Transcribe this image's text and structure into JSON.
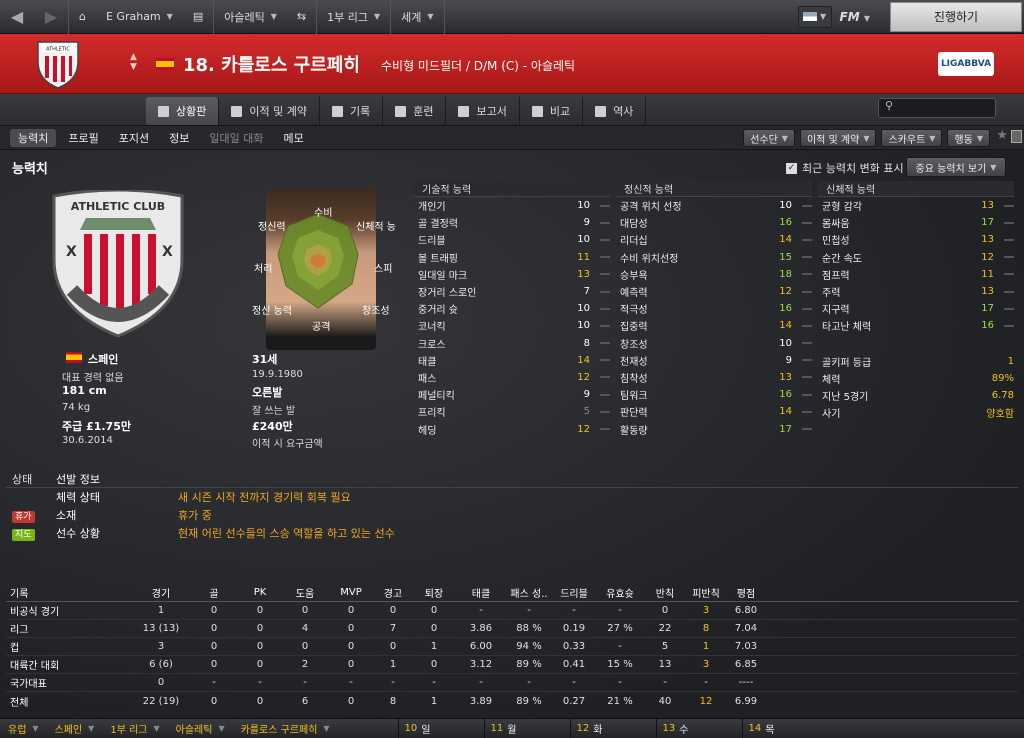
{
  "topbar": {
    "manager": "E Graham",
    "club": "아슬레틱",
    "league": "1부 리그",
    "world": "세계",
    "fm": "FM",
    "continue": "진행하기"
  },
  "header": {
    "player_title": "18. 카를로스 구르페히",
    "position_club": "수비형 미드필더 / D/M (C) - 아슬레틱",
    "league_logo": "LIGABBVA",
    "club_crest_text": "ATHLETIC CLUB"
  },
  "tabs": [
    {
      "label": "상황판",
      "icon": "dashboard-icon"
    },
    {
      "label": "이적 및 계약",
      "icon": "contract-icon"
    },
    {
      "label": "기록",
      "icon": "stats-icon"
    },
    {
      "label": "훈련",
      "icon": "training-icon"
    },
    {
      "label": "보고서",
      "icon": "report-icon"
    },
    {
      "label": "비교",
      "icon": "compare-icon"
    },
    {
      "label": "역사",
      "icon": "history-icon"
    }
  ],
  "search_placeholder": "",
  "subtabs": [
    "능력치",
    "프로필",
    "포지션",
    "정보",
    "일대일 대화",
    "메모"
  ],
  "subtab_active": "능력치",
  "action_buttons": [
    "선수단",
    "이적 및 계약",
    "스카우트",
    "행동"
  ],
  "section_title": "능력치",
  "show_changes_label": "최근 능력치 변화 표시",
  "key_attrs_button": "중요 능력치 보기",
  "radar_labels": {
    "top": "수비",
    "tl": "정신력",
    "tr": "신체적 능",
    "ml": "처리",
    "mr": "스피",
    "bl": "정신 능력",
    "br": "창조성",
    "bottom": "공격"
  },
  "player_info": {
    "nationality": "스페인",
    "intl": "대표 경력 없음",
    "height": "181 cm",
    "weight": "74 kg",
    "wage": "주급 £1.75만",
    "contract_end": "30.6.2014",
    "age": "31세",
    "dob": "19.9.1980",
    "foot": "오른발",
    "foot_detail": "잘 쓰는 발",
    "value": "£240만",
    "transfer_status": "이적 시 요구금액"
  },
  "technical": {
    "title": "기술적 능력",
    "rows": [
      {
        "name": "개인기",
        "value": "10",
        "color": "white"
      },
      {
        "name": "골 결정력",
        "value": "9",
        "color": "white"
      },
      {
        "name": "드리블",
        "value": "10",
        "color": "white"
      },
      {
        "name": "볼 트래핑",
        "value": "11",
        "color": "yellow"
      },
      {
        "name": "일대일 마크",
        "value": "13",
        "color": "yellow"
      },
      {
        "name": "장거리 스로인",
        "value": "7",
        "color": "white"
      },
      {
        "name": "중거리 슛",
        "value": "10",
        "color": "white"
      },
      {
        "name": "코너킥",
        "value": "10",
        "color": "white"
      },
      {
        "name": "크로스",
        "value": "8",
        "color": "white"
      },
      {
        "name": "태클",
        "value": "14",
        "color": "yellow"
      },
      {
        "name": "패스",
        "value": "12",
        "color": "yellow"
      },
      {
        "name": "페널티킥",
        "value": "9",
        "color": "white"
      },
      {
        "name": "프리킥",
        "value": "5",
        "color": "grey"
      },
      {
        "name": "헤딩",
        "value": "12",
        "color": "yellow"
      }
    ]
  },
  "mental": {
    "title": "정신적 능력",
    "rows": [
      {
        "name": "공격 위치 선정",
        "value": "10",
        "color": "white"
      },
      {
        "name": "대담성",
        "value": "16",
        "color": "green"
      },
      {
        "name": "리더십",
        "value": "14",
        "color": "yellow"
      },
      {
        "name": "수비 위치선정",
        "value": "15",
        "color": "green"
      },
      {
        "name": "승부욕",
        "value": "18",
        "color": "green"
      },
      {
        "name": "예측력",
        "value": "12",
        "color": "yellow"
      },
      {
        "name": "적극성",
        "value": "16",
        "color": "green"
      },
      {
        "name": "집중력",
        "value": "14",
        "color": "yellow"
      },
      {
        "name": "창조성",
        "value": "10",
        "color": "white"
      },
      {
        "name": "천재성",
        "value": "9",
        "color": "white"
      },
      {
        "name": "침착성",
        "value": "13",
        "color": "yellow"
      },
      {
        "name": "팀워크",
        "value": "16",
        "color": "green"
      },
      {
        "name": "판단력",
        "value": "14",
        "color": "yellow"
      },
      {
        "name": "활동량",
        "value": "17",
        "color": "green"
      }
    ]
  },
  "physical": {
    "title": "신체적 능력",
    "rows": [
      {
        "name": "균형 감각",
        "value": "13",
        "color": "yellow"
      },
      {
        "name": "몸싸움",
        "value": "17",
        "color": "green"
      },
      {
        "name": "민첩성",
        "value": "13",
        "color": "yellow"
      },
      {
        "name": "순간 속도",
        "value": "12",
        "color": "yellow"
      },
      {
        "name": "점프력",
        "value": "11",
        "color": "yellow"
      },
      {
        "name": "주력",
        "value": "13",
        "color": "yellow"
      },
      {
        "name": "지구력",
        "value": "17",
        "color": "green"
      },
      {
        "name": "타고난 체력",
        "value": "16",
        "color": "green"
      }
    ],
    "extra": [
      {
        "name": "골키퍼 등급",
        "value": "1"
      },
      {
        "name": "체력",
        "value": "89%"
      },
      {
        "name": "지난 5경기",
        "value": "6.78"
      },
      {
        "name": "사기",
        "value": "양호함"
      }
    ]
  },
  "status": {
    "header_k": "상태",
    "header_l": "선발 정보",
    "rows": [
      {
        "badge": "",
        "badge_color": "",
        "label": "체력 상태",
        "text": "새 시즌 시작 전까지 경기력 회복 필요"
      },
      {
        "badge": "휴가",
        "badge_color": "#c0392b",
        "label": "소재",
        "text": "휴가 중"
      },
      {
        "badge": "지도",
        "badge_color": "#7ab317",
        "label": "선수 상황",
        "text": "현재 어린 선수들의 스승 역할을 하고 있는 선수"
      }
    ]
  },
  "stats": {
    "headers": [
      "기록",
      "경기",
      "골",
      "PK",
      "도움",
      "MVP",
      "경고",
      "퇴장",
      "태클",
      "패스 성..",
      "드리블",
      "유효슛",
      "반칙",
      "피반칙",
      "평점"
    ],
    "rows": [
      [
        "비공식 경기",
        "1",
        "0",
        "0",
        "0",
        "0",
        "0",
        "0",
        "-",
        "-",
        "-",
        "-",
        "0",
        "3",
        "6.80"
      ],
      [
        "리그",
        "13 (13)",
        "0",
        "0",
        "4",
        "0",
        "7",
        "0",
        "3.86",
        "88 %",
        "0.19",
        "27 %",
        "22",
        "8",
        "7.04"
      ],
      [
        "컵",
        "3",
        "0",
        "0",
        "0",
        "0",
        "0",
        "1",
        "6.00",
        "94 %",
        "0.33",
        "-",
        "5",
        "1",
        "7.03"
      ],
      [
        "대륙간 대회",
        "6 (6)",
        "0",
        "0",
        "2",
        "0",
        "1",
        "0",
        "3.12",
        "89 %",
        "0.41",
        "15 %",
        "13",
        "3",
        "6.85"
      ],
      [
        "국가대표",
        "0",
        "-",
        "-",
        "-",
        "-",
        "-",
        "-",
        "-",
        "-",
        "-",
        "-",
        "-",
        "-",
        "----"
      ],
      [
        "전체",
        "22 (19)",
        "0",
        "0",
        "6",
        "0",
        "8",
        "1",
        "3.89",
        "89 %",
        "0.27",
        "21 %",
        "40",
        "12",
        "6.99"
      ]
    ]
  },
  "bottombar": {
    "crumbs": [
      "유럽",
      "스페인",
      "1부 리그",
      "아슬레틱",
      "카를로스 구르페히"
    ],
    "days": [
      {
        "num": "10",
        "day": "일"
      },
      {
        "num": "11",
        "day": "월"
      },
      {
        "num": "12",
        "day": "화"
      },
      {
        "num": "13",
        "day": "수"
      },
      {
        "num": "14",
        "day": "목"
      }
    ]
  }
}
